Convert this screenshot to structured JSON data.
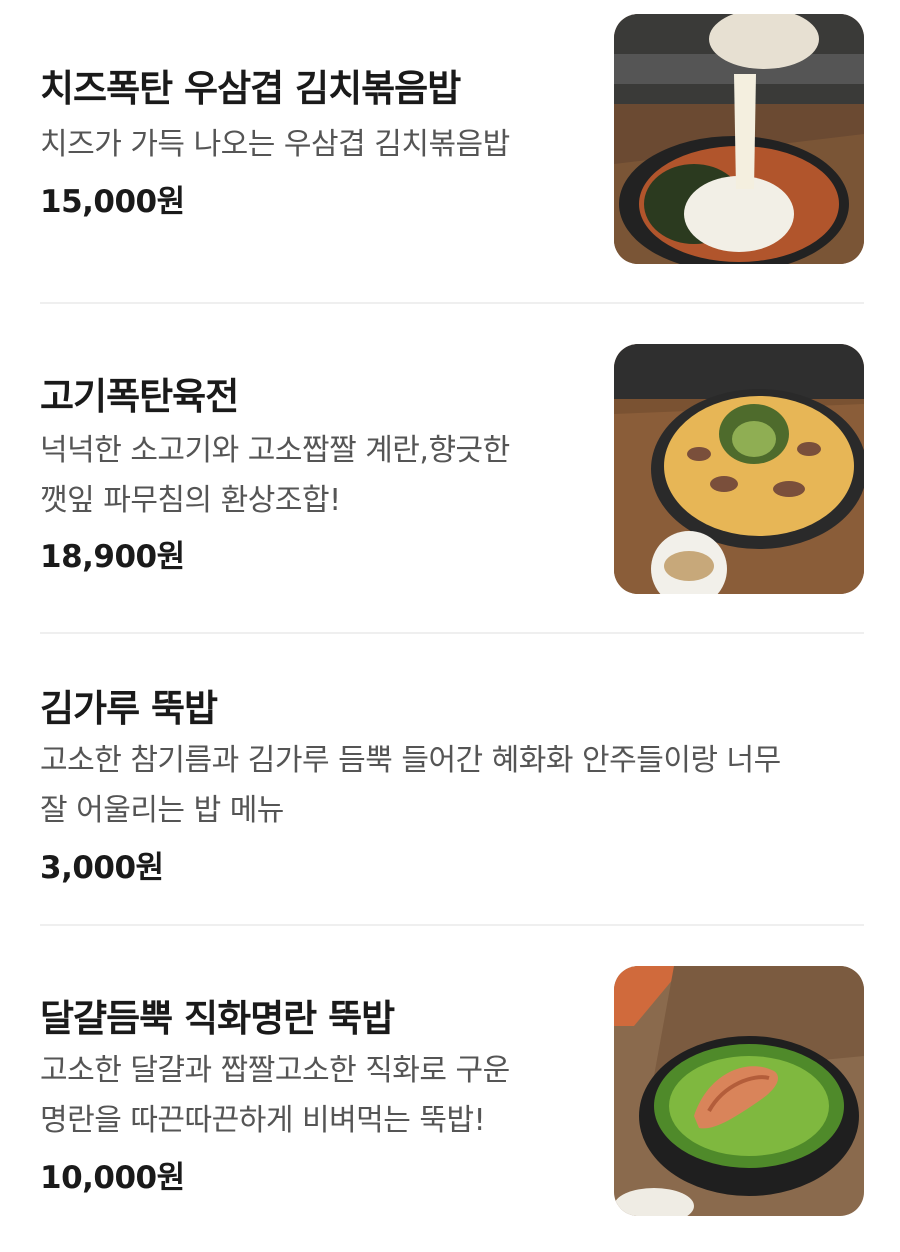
{
  "menu": {
    "items": [
      {
        "name": "치즈폭탄 우삼겹 김치볶음밥",
        "description_lines": [
          "치즈가 가득 나오는 우삼겹 김치볶음밥"
        ],
        "price": "15,000원",
        "photo_icon": "kimchi-fried-rice-cheese-photo"
      },
      {
        "name": "고기폭탄육전",
        "description_lines": [
          "넉넉한 소고기와 고소짭짤 계란,향긋한",
          "깻잎 파무침의 환상조합!"
        ],
        "price": "18,900원",
        "photo_icon": "beef-pancake-photo"
      },
      {
        "name": "김가루 뚝밥",
        "description_lines": [
          "고소한 참기름과 김가루 듬뿍 들어간 혜화화 안주들이랑 너무",
          "잘 어울리는 밥 메뉴"
        ],
        "price": "3,000원"
      },
      {
        "name": "달걀듬뿍 직화명란 뚝밥",
        "description_lines": [
          "고소한 달걀과 짭짤고소한 직화로 구운",
          "명란을 따끈따끈하게 비벼먹는 뚝밥!"
        ],
        "price": "10,000원",
        "photo_icon": "pollock-roe-rice-pot-photo"
      }
    ]
  }
}
